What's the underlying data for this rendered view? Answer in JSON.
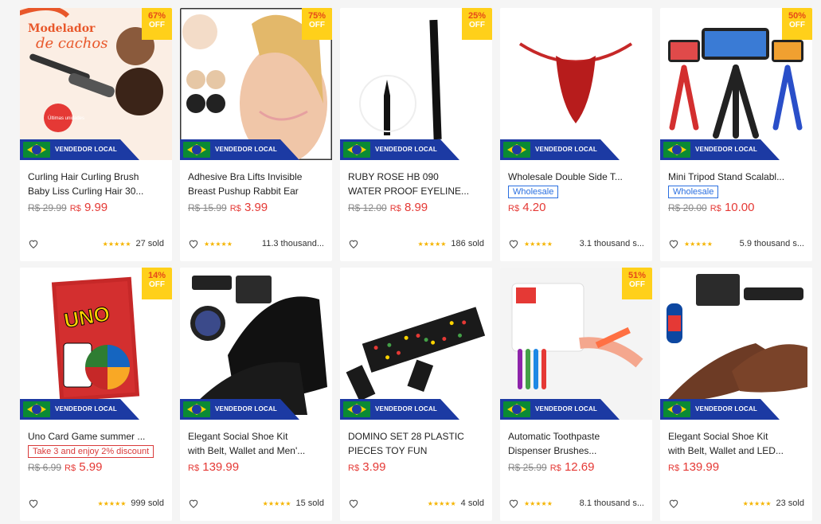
{
  "seller_label": "VENDEDOR LOCAL",
  "colors": {
    "price": "#e53935",
    "badge": "#ffd01a",
    "seller_band": "#1c3aa3",
    "wholesale": "#2a6fe0",
    "promo": "#d93a3a"
  },
  "products": [
    {
      "title1": "Curling Hair Curling Brush",
      "title2": "Baby Liss Curling Hair 30...",
      "old": "R$ 29.99",
      "cur": "9.99",
      "badge": "67%",
      "off": "OFF",
      "sold": "27 sold",
      "img_text1": "Modelador",
      "img_text2": "de cachos",
      "img_text3": "Últimas unidades"
    },
    {
      "title1": "Adhesive Bra Lifts Invisible",
      "title2": "Breast Pushup Rabbit Ear",
      "old": "R$ 15.99",
      "cur": "3.99",
      "badge": "75%",
      "off": "OFF",
      "sold": "11.3 thousand..."
    },
    {
      "title1": "RUBY ROSE HB 090",
      "title2": "WATER PROOF EYELINE...",
      "old": "R$ 12.00",
      "cur": "8.99",
      "badge": "25%",
      "off": "OFF",
      "sold": "186 sold"
    },
    {
      "title1": "Wholesale Double Side T...",
      "title2": "",
      "tag": "Wholesale",
      "cur": "4.20",
      "sold": "3.1 thousand s..."
    },
    {
      "title1": "Mini Tripod Stand Scalabl...",
      "title2": "",
      "tag": "Wholesale",
      "old": "R$ 20.00",
      "cur": "10.00",
      "badge": "50%",
      "off": "OFF",
      "sold": "5.9 thousand s..."
    },
    {
      "title1": "Uno Card Game summer ...",
      "title2": "",
      "promo": "Take 3 and enjoy 2% discount",
      "old": "R$ 6.99",
      "cur": "5.99",
      "badge": "14%",
      "off": "OFF",
      "sold": "999 sold",
      "img_text1": "UNO"
    },
    {
      "title1": "Elegant Social Shoe Kit",
      "title2": "with Belt, Wallet and Men'...",
      "cur": "139.99",
      "sold": "15 sold"
    },
    {
      "title1": "DOMINO SET 28 PLASTIC",
      "title2": "PIECES TOY FUN",
      "cur": "3.99",
      "sold": "4 sold"
    },
    {
      "title1": "Automatic Toothpaste",
      "title2": "Dispenser Brushes...",
      "old": "R$ 25.99",
      "cur": "12.69",
      "badge": "51%",
      "off": "OFF",
      "sold": "8.1 thousand s..."
    },
    {
      "title1": "Elegant Social Shoe Kit",
      "title2": "with Belt, Wallet and LED...",
      "cur": "139.99",
      "sold": "23 sold"
    }
  ],
  "currency": "R$",
  "stars": "★★★★★"
}
